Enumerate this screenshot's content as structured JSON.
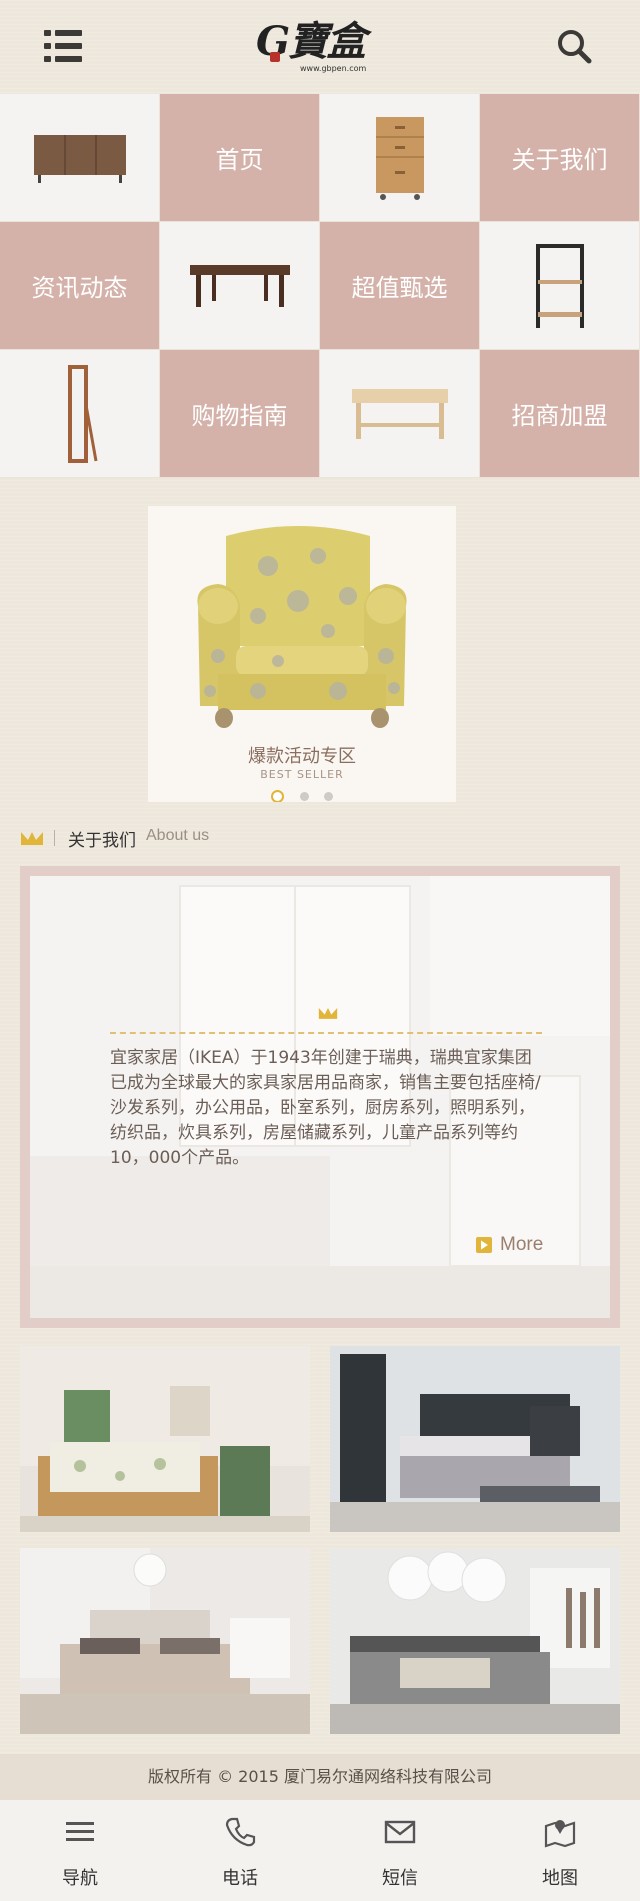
{
  "header": {
    "logo_text": "G寶盒",
    "logo_url": "www.gbpen.com"
  },
  "grid": {
    "nav": [
      {
        "label": "首页"
      },
      {
        "label": "关于我们"
      },
      {
        "label": "资讯动态"
      },
      {
        "label": "超值甄选"
      },
      {
        "label": "购物指南"
      },
      {
        "label": "招商加盟"
      }
    ]
  },
  "banner": {
    "title": "爆款活动专区",
    "subtitle": "BEST SELLER",
    "slides": 3,
    "active_slide": 1
  },
  "about": {
    "title": "关于我们",
    "title_en": "About us",
    "text": "宜家家居（IKEA）于1943年创建于瑞典，瑞典宜家集团已成为全球最大的家具家居用品商家，销售主要包括座椅/沙发系列，办公用品，卧室系列，厨房系列，照明系列，纺织品，炊具系列，房屋储藏系列，儿童产品系列等约10，000个产品。",
    "more": "More"
  },
  "footer": {
    "copyright": "版权所有 © 2015 厦门易尔通网络科技有限公司"
  },
  "bottom_nav": [
    {
      "label": "导航",
      "icon": "menu-icon"
    },
    {
      "label": "电话",
      "icon": "phone-icon"
    },
    {
      "label": "短信",
      "icon": "envelope-icon"
    },
    {
      "label": "地图",
      "icon": "map-icon"
    }
  ],
  "colors": {
    "nav_tile": "#d4b2aa",
    "accent_gold": "#e0b53a",
    "about_border": "#e3cdc8"
  }
}
